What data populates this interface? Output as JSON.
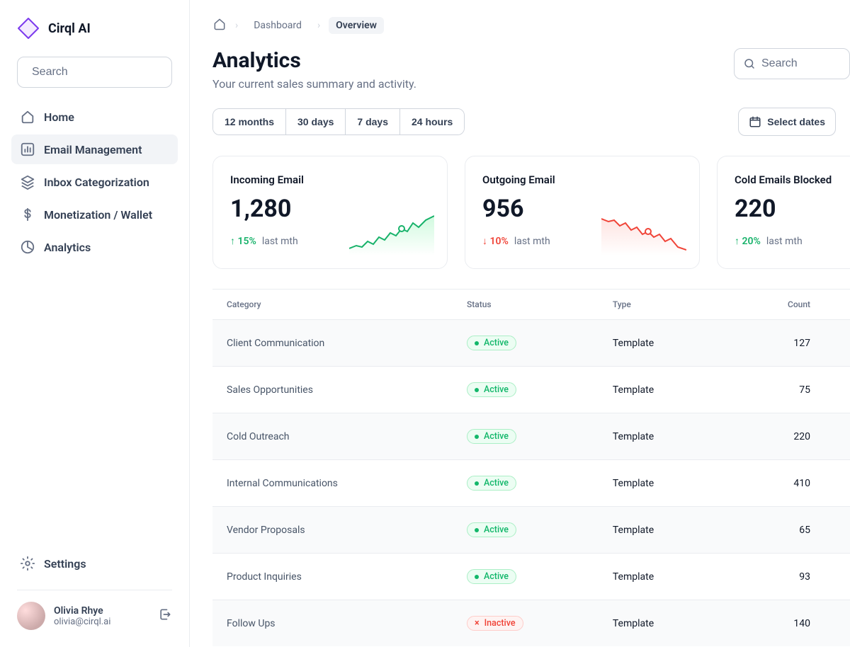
{
  "brand": {
    "name": "Cirql AI"
  },
  "sidebar": {
    "search_placeholder": "Search",
    "items": [
      {
        "label": "Home"
      },
      {
        "label": "Email Management"
      },
      {
        "label": "Inbox Categorization"
      },
      {
        "label": "Monetization / Wallet"
      },
      {
        "label": "Analytics"
      }
    ],
    "settings_label": "Settings",
    "user": {
      "name": "Olivia Rhye",
      "email": "olivia@cirql.ai"
    }
  },
  "breadcrumb": {
    "home_icon": "home",
    "steps": [
      {
        "label": "Dashboard"
      },
      {
        "label": "Overview"
      }
    ]
  },
  "page": {
    "title": "Analytics",
    "subtitle": "Your current sales summary and activity."
  },
  "top_search_placeholder": "Search",
  "segments": [
    "12 months",
    "30 days",
    "7 days",
    "24 hours"
  ],
  "select_dates_label": "Select dates",
  "cards": [
    {
      "title": "Incoming Email",
      "value": "1,280",
      "delta_pct": "15%",
      "delta_dir": "up",
      "period": "last mth"
    },
    {
      "title": "Outgoing Email",
      "value": "956",
      "delta_pct": "10%",
      "delta_dir": "down",
      "period": "last mth"
    },
    {
      "title": "Cold Emails Blocked",
      "value": "220",
      "delta_pct": "20%",
      "delta_dir": "up",
      "period": "last mth"
    }
  ],
  "table": {
    "headers": {
      "category": "Category",
      "status": "Status",
      "type": "Type",
      "count": "Count"
    },
    "status_labels": {
      "active": "Active",
      "inactive": "Inactive"
    },
    "type_label": "Template",
    "rows": [
      {
        "category": "Client Communication",
        "status": "active",
        "count": "127"
      },
      {
        "category": "Sales Opportunities",
        "status": "active",
        "count": "75"
      },
      {
        "category": "Cold Outreach",
        "status": "active",
        "count": "220"
      },
      {
        "category": "Internal Communications",
        "status": "active",
        "count": "410"
      },
      {
        "category": "Vendor Proposals",
        "status": "active",
        "count": "65"
      },
      {
        "category": "Product Inquiries",
        "status": "active",
        "count": "93"
      },
      {
        "category": "Follow Ups",
        "status": "inactive",
        "count": "140"
      }
    ]
  },
  "chart_data": [
    {
      "type": "line",
      "title": "Incoming Email sparkline",
      "y": [
        30,
        28,
        34,
        31,
        38,
        36,
        44,
        40,
        47,
        45,
        52,
        50,
        58,
        55,
        62,
        60,
        68
      ],
      "color": "#17B26A",
      "note": "approximate upward trend"
    },
    {
      "type": "line",
      "title": "Outgoing Email sparkline",
      "y": [
        62,
        60,
        55,
        58,
        50,
        52,
        46,
        48,
        42,
        44,
        38,
        40,
        34,
        36,
        30,
        32,
        26
      ],
      "color": "#F04438",
      "note": "approximate downward trend"
    }
  ]
}
